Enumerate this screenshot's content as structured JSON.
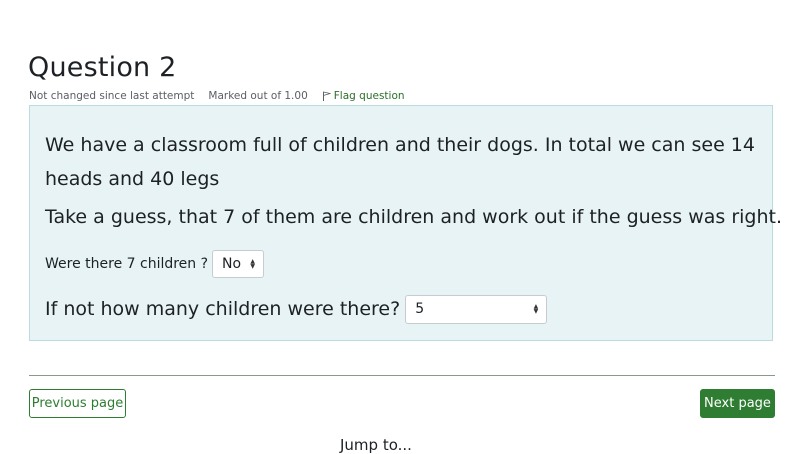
{
  "question": {
    "title": "Question 2",
    "status": "Not changed since last attempt",
    "marked": "Marked out of 1.00",
    "flag_label": "Flag question",
    "text_1": "We have a classroom full of children and their dogs. In total we can see 14 heads and 40 legs",
    "text_2": "Take a guess, that 7 of them are children and work out if the guess was right.",
    "prompt_1": "Were there 7 children ?",
    "select_1_value": "No",
    "prompt_2": "If not how many children were there?",
    "select_2_value": "5"
  },
  "nav": {
    "prev_label": "Previous page",
    "next_label": "Next page"
  },
  "footer": {
    "partial_text": "Jump to..."
  },
  "colors": {
    "accent": "#2e7d32",
    "content_bg": "#e7f3f5",
    "content_border": "#b8dce2"
  },
  "icons": {
    "flag": "flag-icon",
    "select_arrows": "select-arrows-icon"
  }
}
